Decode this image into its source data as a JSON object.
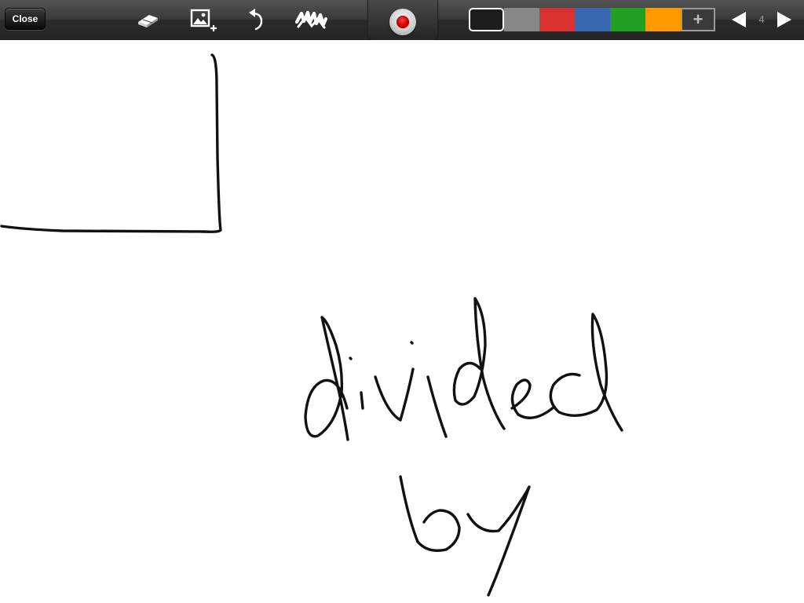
{
  "toolbar": {
    "close_label": "Close",
    "tools": [
      {
        "icon": "eraser-icon"
      },
      {
        "icon": "insert-image-icon"
      },
      {
        "icon": "undo-icon"
      },
      {
        "icon": "clear-scribble-icon"
      }
    ],
    "record_icon": "record-icon",
    "colors": [
      "#1c1c1c",
      "#888888",
      "#d93030",
      "#3a68b0",
      "#23a023",
      "#ff9900"
    ],
    "selected_color_index": 0,
    "add_color_label": "+",
    "page_number": "4",
    "prev_icon": "triangle-left-icon",
    "next_icon": "triangle-right-icon"
  },
  "canvas": {
    "ink_color": "#111111",
    "handwriting": [
      "divided",
      "by"
    ]
  }
}
